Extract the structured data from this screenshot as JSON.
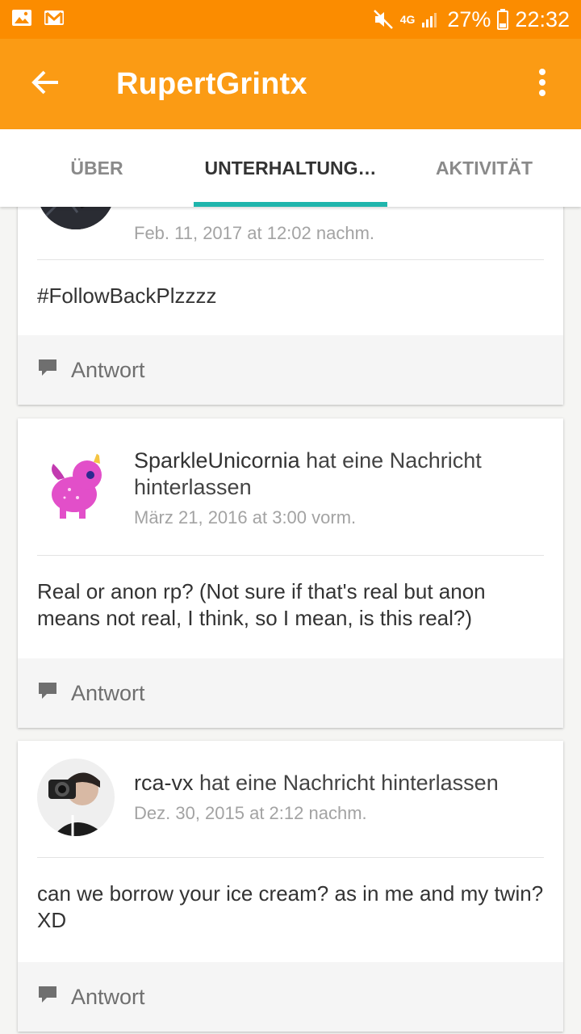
{
  "status_bar": {
    "network": "4G",
    "battery": "27%",
    "time": "22:32"
  },
  "app_bar": {
    "title": "RupertGrintx"
  },
  "tabs": [
    {
      "label": "ÜBER",
      "active": false
    },
    {
      "label": "UNTERHALTUNG…",
      "active": true
    },
    {
      "label": "AKTIVITÄT",
      "active": false
    }
  ],
  "posts": [
    {
      "author": "",
      "action": "",
      "timestamp": "Feb. 11, 2017 at 12:02 nachm.",
      "message": "#FollowBackPlzzzz",
      "reply_label": "Antwort"
    },
    {
      "author": "SparkleUnicornia",
      "action": " hat eine Nachricht hinterlassen",
      "timestamp": "März 21, 2016 at 3:00 vorm.",
      "message": "Real or anon rp? (Not sure if that's real but anon means not real, I think, so I mean, is this real?)",
      "reply_label": "Antwort"
    },
    {
      "author": "rca-vx",
      "action": " hat eine Nachricht hinterlassen",
      "timestamp": "Dez. 30, 2015 at 2:12 nachm.",
      "message": "can we borrow your ice cream? as in me and my twin? XD",
      "reply_label": "Antwort"
    }
  ],
  "colors": {
    "status_bar": "#fb8c00",
    "app_bar": "#fb9b14",
    "tab_indicator": "#1fb5ac"
  }
}
